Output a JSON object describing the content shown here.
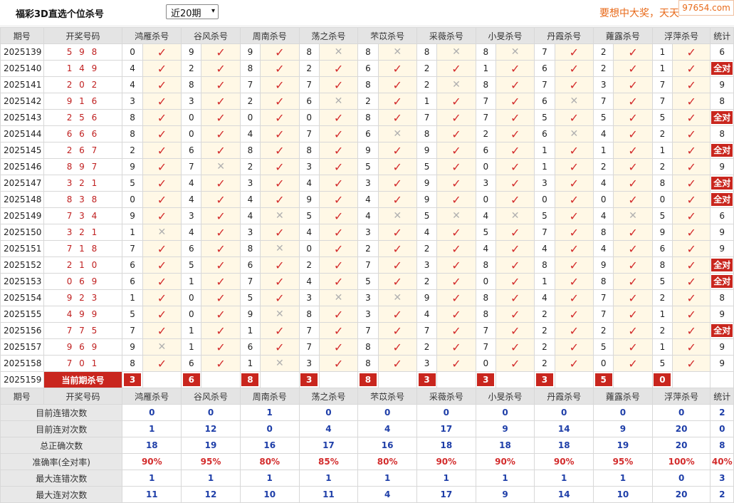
{
  "header": {
    "title": "福彩3D直选个位杀号",
    "period_select": "近20期",
    "slogan": "要想中大奖，天天",
    "logo": "97654.com"
  },
  "columns": [
    "期号",
    "开奖号码",
    "鸿雁杀号",
    "谷风杀号",
    "周南杀号",
    "荡之杀号",
    "芣苡杀号",
    "采薇杀号",
    "小旻杀号",
    "丹霞杀号",
    "蕹露杀号",
    "浮萍杀号",
    "统计"
  ],
  "full_label": "全对",
  "rows": [
    {
      "issue": "2025139",
      "draw": "5 9 8",
      "kills": [
        [
          "0",
          1
        ],
        [
          "9",
          1
        ],
        [
          "9",
          1
        ],
        [
          "8",
          0
        ],
        [
          "8",
          0
        ],
        [
          "8",
          0
        ],
        [
          "8",
          0
        ],
        [
          "7",
          1
        ],
        [
          "2",
          1
        ],
        [
          "1",
          1
        ]
      ],
      "stat": "6"
    },
    {
      "issue": "2025140",
      "draw": "1 4 9",
      "kills": [
        [
          "4",
          1
        ],
        [
          "2",
          1
        ],
        [
          "8",
          1
        ],
        [
          "2",
          1
        ],
        [
          "6",
          1
        ],
        [
          "2",
          1
        ],
        [
          "1",
          1
        ],
        [
          "6",
          1
        ],
        [
          "2",
          1
        ],
        [
          "1",
          1
        ]
      ],
      "stat": "全对"
    },
    {
      "issue": "2025141",
      "draw": "2 0 2",
      "kills": [
        [
          "4",
          1
        ],
        [
          "8",
          1
        ],
        [
          "7",
          1
        ],
        [
          "7",
          1
        ],
        [
          "8",
          1
        ],
        [
          "2",
          0
        ],
        [
          "8",
          1
        ],
        [
          "7",
          1
        ],
        [
          "3",
          1
        ],
        [
          "7",
          1
        ]
      ],
      "stat": "9"
    },
    {
      "issue": "2025142",
      "draw": "9 1 6",
      "kills": [
        [
          "3",
          1
        ],
        [
          "3",
          1
        ],
        [
          "2",
          1
        ],
        [
          "6",
          0
        ],
        [
          "2",
          1
        ],
        [
          "1",
          1
        ],
        [
          "7",
          1
        ],
        [
          "6",
          0
        ],
        [
          "7",
          1
        ],
        [
          "7",
          1
        ]
      ],
      "stat": "8"
    },
    {
      "issue": "2025143",
      "draw": "2 5 6",
      "kills": [
        [
          "8",
          1
        ],
        [
          "0",
          1
        ],
        [
          "0",
          1
        ],
        [
          "0",
          1
        ],
        [
          "8",
          1
        ],
        [
          "7",
          1
        ],
        [
          "7",
          1
        ],
        [
          "5",
          1
        ],
        [
          "5",
          1
        ],
        [
          "5",
          1
        ]
      ],
      "stat": "全对"
    },
    {
      "issue": "2025144",
      "draw": "6 6 6",
      "kills": [
        [
          "8",
          1
        ],
        [
          "0",
          1
        ],
        [
          "4",
          1
        ],
        [
          "7",
          1
        ],
        [
          "6",
          0
        ],
        [
          "8",
          1
        ],
        [
          "2",
          1
        ],
        [
          "6",
          0
        ],
        [
          "4",
          1
        ],
        [
          "2",
          1
        ]
      ],
      "stat": "8"
    },
    {
      "issue": "2025145",
      "draw": "2 6 7",
      "kills": [
        [
          "2",
          1
        ],
        [
          "6",
          1
        ],
        [
          "8",
          1
        ],
        [
          "8",
          1
        ],
        [
          "9",
          1
        ],
        [
          "9",
          1
        ],
        [
          "6",
          1
        ],
        [
          "1",
          1
        ],
        [
          "1",
          1
        ],
        [
          "1",
          1
        ]
      ],
      "stat": "全对"
    },
    {
      "issue": "2025146",
      "draw": "8 9 7",
      "kills": [
        [
          "9",
          1
        ],
        [
          "7",
          0
        ],
        [
          "2",
          1
        ],
        [
          "3",
          1
        ],
        [
          "5",
          1
        ],
        [
          "5",
          1
        ],
        [
          "0",
          1
        ],
        [
          "1",
          1
        ],
        [
          "2",
          1
        ],
        [
          "2",
          1
        ]
      ],
      "stat": "9"
    },
    {
      "issue": "2025147",
      "draw": "3 2 1",
      "kills": [
        [
          "5",
          1
        ],
        [
          "4",
          1
        ],
        [
          "3",
          1
        ],
        [
          "4",
          1
        ],
        [
          "3",
          1
        ],
        [
          "9",
          1
        ],
        [
          "3",
          1
        ],
        [
          "3",
          1
        ],
        [
          "4",
          1
        ],
        [
          "8",
          1
        ]
      ],
      "stat": "全对"
    },
    {
      "issue": "2025148",
      "draw": "8 3 8",
      "kills": [
        [
          "0",
          1
        ],
        [
          "4",
          1
        ],
        [
          "4",
          1
        ],
        [
          "9",
          1
        ],
        [
          "4",
          1
        ],
        [
          "9",
          1
        ],
        [
          "0",
          1
        ],
        [
          "0",
          1
        ],
        [
          "0",
          1
        ],
        [
          "0",
          1
        ]
      ],
      "stat": "全对"
    },
    {
      "issue": "2025149",
      "draw": "7 3 4",
      "kills": [
        [
          "9",
          1
        ],
        [
          "3",
          1
        ],
        [
          "4",
          0
        ],
        [
          "5",
          1
        ],
        [
          "4",
          0
        ],
        [
          "5",
          0
        ],
        [
          "4",
          0
        ],
        [
          "5",
          1
        ],
        [
          "4",
          0
        ],
        [
          "5",
          1
        ]
      ],
      "stat": "6"
    },
    {
      "issue": "2025150",
      "draw": "3 2 1",
      "kills": [
        [
          "1",
          0
        ],
        [
          "4",
          1
        ],
        [
          "3",
          1
        ],
        [
          "4",
          1
        ],
        [
          "3",
          1
        ],
        [
          "4",
          1
        ],
        [
          "5",
          1
        ],
        [
          "7",
          1
        ],
        [
          "8",
          1
        ],
        [
          "9",
          1
        ]
      ],
      "stat": "9"
    },
    {
      "issue": "2025151",
      "draw": "7 1 8",
      "kills": [
        [
          "7",
          1
        ],
        [
          "6",
          1
        ],
        [
          "8",
          0
        ],
        [
          "0",
          1
        ],
        [
          "2",
          1
        ],
        [
          "2",
          1
        ],
        [
          "4",
          1
        ],
        [
          "4",
          1
        ],
        [
          "4",
          1
        ],
        [
          "6",
          1
        ]
      ],
      "stat": "9"
    },
    {
      "issue": "2025152",
      "draw": "2 1 0",
      "kills": [
        [
          "6",
          1
        ],
        [
          "5",
          1
        ],
        [
          "6",
          1
        ],
        [
          "2",
          1
        ],
        [
          "7",
          1
        ],
        [
          "3",
          1
        ],
        [
          "8",
          1
        ],
        [
          "8",
          1
        ],
        [
          "9",
          1
        ],
        [
          "8",
          1
        ]
      ],
      "stat": "全对"
    },
    {
      "issue": "2025153",
      "draw": "0 6 9",
      "kills": [
        [
          "6",
          1
        ],
        [
          "1",
          1
        ],
        [
          "7",
          1
        ],
        [
          "4",
          1
        ],
        [
          "5",
          1
        ],
        [
          "2",
          1
        ],
        [
          "0",
          1
        ],
        [
          "1",
          1
        ],
        [
          "8",
          1
        ],
        [
          "5",
          1
        ]
      ],
      "stat": "全对"
    },
    {
      "issue": "2025154",
      "draw": "9 2 3",
      "kills": [
        [
          "1",
          1
        ],
        [
          "0",
          1
        ],
        [
          "5",
          1
        ],
        [
          "3",
          0
        ],
        [
          "3",
          0
        ],
        [
          "9",
          1
        ],
        [
          "8",
          1
        ],
        [
          "4",
          1
        ],
        [
          "7",
          1
        ],
        [
          "2",
          1
        ]
      ],
      "stat": "8"
    },
    {
      "issue": "2025155",
      "draw": "4 9 9",
      "kills": [
        [
          "5",
          1
        ],
        [
          "0",
          1
        ],
        [
          "9",
          0
        ],
        [
          "8",
          1
        ],
        [
          "3",
          1
        ],
        [
          "4",
          1
        ],
        [
          "8",
          1
        ],
        [
          "2",
          1
        ],
        [
          "7",
          1
        ],
        [
          "1",
          1
        ]
      ],
      "stat": "9"
    },
    {
      "issue": "2025156",
      "draw": "7 7 5",
      "kills": [
        [
          "7",
          1
        ],
        [
          "1",
          1
        ],
        [
          "1",
          1
        ],
        [
          "7",
          1
        ],
        [
          "7",
          1
        ],
        [
          "7",
          1
        ],
        [
          "7",
          1
        ],
        [
          "2",
          1
        ],
        [
          "2",
          1
        ],
        [
          "2",
          1
        ]
      ],
      "stat": "全对"
    },
    {
      "issue": "2025157",
      "draw": "9 6 9",
      "kills": [
        [
          "9",
          0
        ],
        [
          "1",
          1
        ],
        [
          "6",
          1
        ],
        [
          "7",
          1
        ],
        [
          "8",
          1
        ],
        [
          "2",
          1
        ],
        [
          "7",
          1
        ],
        [
          "2",
          1
        ],
        [
          "5",
          1
        ],
        [
          "1",
          1
        ]
      ],
      "stat": "9"
    },
    {
      "issue": "2025158",
      "draw": "7 0 1",
      "kills": [
        [
          "8",
          1
        ],
        [
          "6",
          1
        ],
        [
          "1",
          0
        ],
        [
          "3",
          1
        ],
        [
          "8",
          1
        ],
        [
          "3",
          1
        ],
        [
          "0",
          1
        ],
        [
          "2",
          1
        ],
        [
          "0",
          1
        ],
        [
          "5",
          1
        ]
      ],
      "stat": "9"
    }
  ],
  "current": {
    "issue": "2025159",
    "label": "当前期杀号",
    "kills": [
      "3",
      "6",
      "8",
      "3",
      "8",
      "3",
      "3",
      "3",
      "5",
      "0"
    ]
  },
  "stats": [
    {
      "label": "目前连错次数",
      "values": [
        "0",
        "0",
        "1",
        "0",
        "0",
        "0",
        "0",
        "0",
        "0",
        "0",
        "2"
      ],
      "red": false
    },
    {
      "label": "目前连对次数",
      "values": [
        "1",
        "12",
        "0",
        "4",
        "4",
        "17",
        "9",
        "14",
        "9",
        "20",
        "0"
      ],
      "red": false
    },
    {
      "label": "总正确次数",
      "values": [
        "18",
        "19",
        "16",
        "17",
        "16",
        "18",
        "18",
        "18",
        "19",
        "20",
        "8"
      ],
      "red": false
    },
    {
      "label": "准确率(全对率)",
      "values": [
        "90%",
        "95%",
        "80%",
        "85%",
        "80%",
        "90%",
        "90%",
        "90%",
        "95%",
        "100%",
        "40%"
      ],
      "red": true
    },
    {
      "label": "最大连错次数",
      "values": [
        "1",
        "1",
        "1",
        "1",
        "1",
        "1",
        "1",
        "1",
        "1",
        "0",
        "3"
      ],
      "red": false
    },
    {
      "label": "最大连对次数",
      "values": [
        "11",
        "12",
        "10",
        "11",
        "4",
        "17",
        "9",
        "14",
        "10",
        "20",
        "2"
      ],
      "red": false
    }
  ],
  "icons": {
    "correct": "check-icon",
    "wrong": "cross-icon"
  },
  "colors": {
    "accent": "#c9261e",
    "check": "#d32c2c",
    "stat_blue": "#1e3ea8",
    "slogan": "#e86a1a"
  }
}
